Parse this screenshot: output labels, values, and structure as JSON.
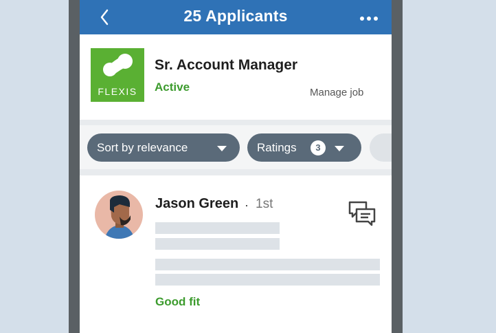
{
  "header": {
    "title": "25 Applicants",
    "back_icon": "chevron-left-icon",
    "menu_icon": "more-horizontal-icon",
    "bar_color": "#2f72b6"
  },
  "job": {
    "logo_text": "FLEXIS",
    "logo_color": "#5ab033",
    "title": "Sr. Account Manager",
    "status": "Active",
    "manage_label": "Manage job"
  },
  "filters": {
    "sort_label": "Sort by relevance",
    "ratings_label": "Ratings",
    "ratings_count": "3",
    "pill_color": "#5a6a79"
  },
  "applicant": {
    "name": "Jason Green",
    "separator": "·",
    "degree": "1st",
    "fit_label": "Good fit",
    "message_icon": "message-bubbles-icon",
    "accent": "#3c9b2d"
  }
}
